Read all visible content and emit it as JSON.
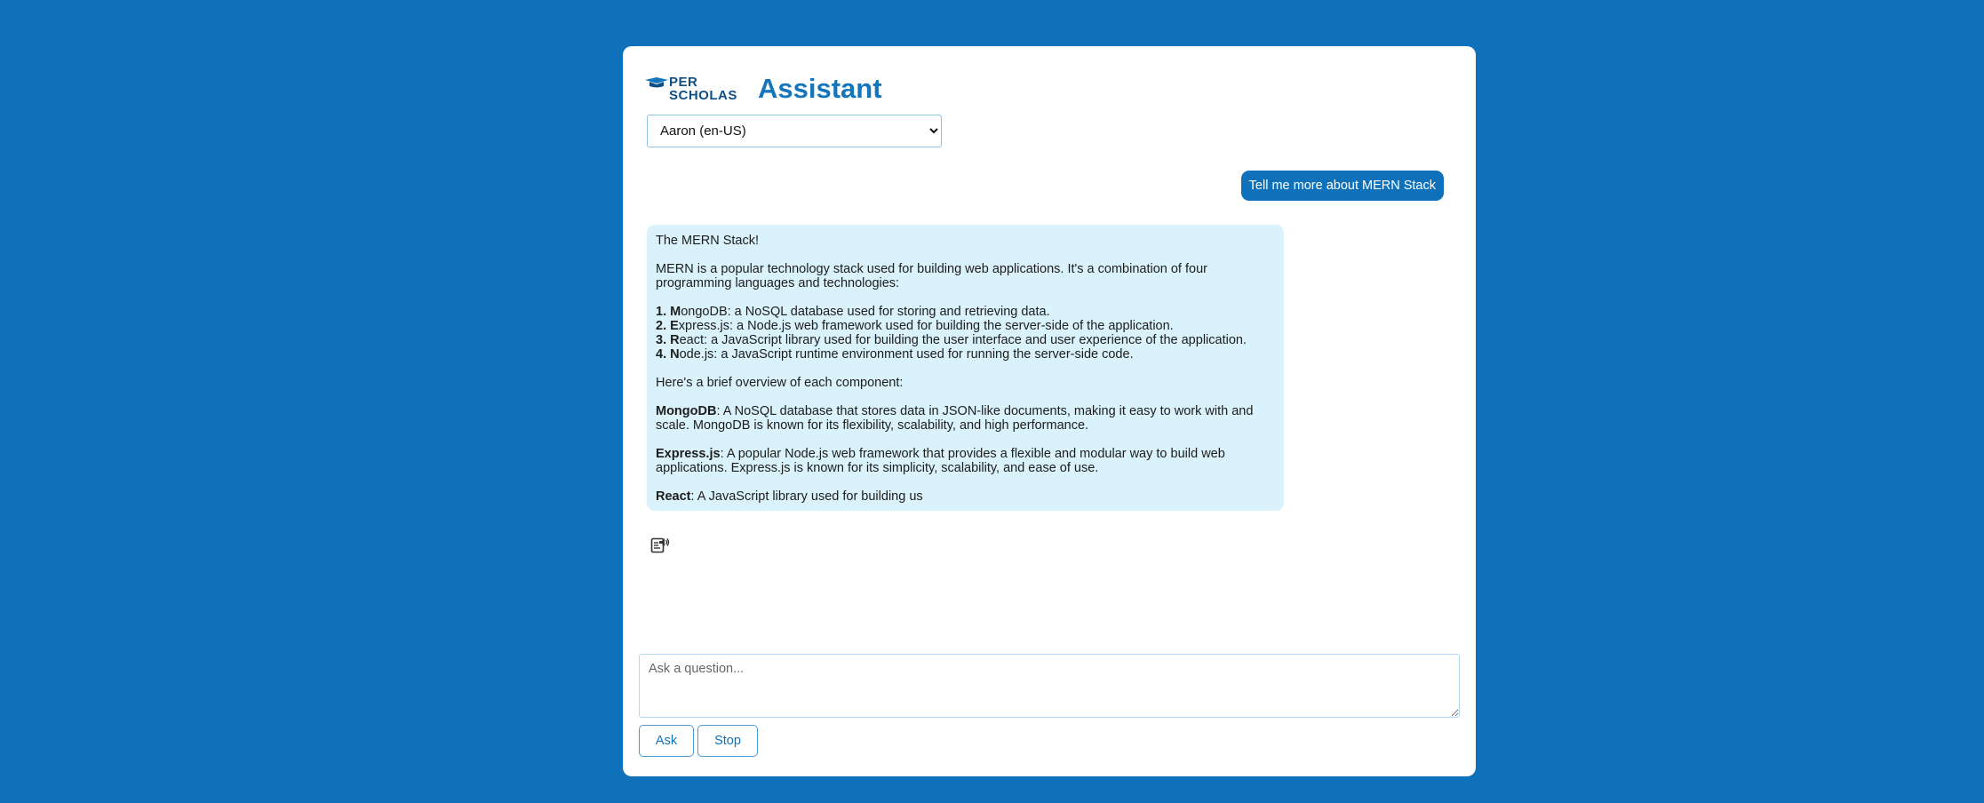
{
  "header": {
    "logo_line1": "PER",
    "logo_line2": "SCHOLAS",
    "title": "Assistant"
  },
  "voice_select": {
    "selected": "Aaron (en-US)",
    "options": [
      "Aaron (en-US)"
    ]
  },
  "conversation": {
    "user_message": "Tell me more about MERN Stack",
    "bot": {
      "intro": "The MERN Stack!",
      "paragraph1": "MERN is a popular technology stack used for building web applications. It's a combination of four programming languages and technologies:",
      "list": [
        {
          "num": "1. ",
          "letter": "M",
          "rest": "ongoDB: a NoSQL database used for storing and retrieving data."
        },
        {
          "num": "2. ",
          "letter": "E",
          "rest": "xpress.js: a Node.js web framework used for building the server-side of the application."
        },
        {
          "num": "3. ",
          "letter": "R",
          "rest": "eact: a JavaScript library used for building the user interface and user experience of the application."
        },
        {
          "num": "4. ",
          "letter": "N",
          "rest": "ode.js: a JavaScript runtime environment used for running the server-side code."
        }
      ],
      "overview": "Here's a brief overview of each component:",
      "components": [
        {
          "name": "MongoDB",
          "text": ": A NoSQL database that stores data in JSON-like documents, making it easy to work with and scale. MongoDB is known for its flexibility, scalability, and high performance."
        },
        {
          "name": "Express.js",
          "text": ": A popular Node.js web framework that provides a flexible and modular way to build web applications. Express.js is known for its simplicity, scalability, and ease of use."
        },
        {
          "name": "React",
          "text": ": A JavaScript library used for building us"
        }
      ]
    },
    "speak_icon": "speaker-icon"
  },
  "input": {
    "placeholder": "Ask a question...",
    "value": ""
  },
  "buttons": {
    "ask": "Ask",
    "stop": "Stop"
  },
  "colors": {
    "background": "#0f71b9",
    "accent": "#1376bd",
    "bot_bubble": "#d9f2fb",
    "user_bubble": "#0f71b9"
  }
}
